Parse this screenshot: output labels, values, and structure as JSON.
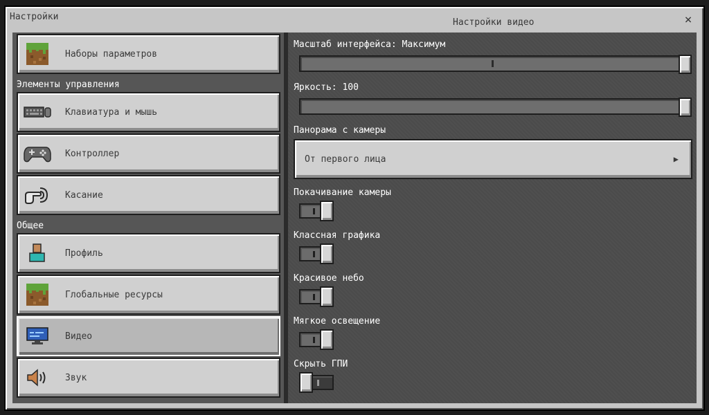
{
  "header": {
    "left_title": "Настройки",
    "center_title": "Настройки видео",
    "close_glyph": "×"
  },
  "sidebar": {
    "top_item": {
      "label": "Наборы параметров",
      "icon": "grass-block-icon"
    },
    "section_controls": "Элементы управления",
    "controls": [
      {
        "label": "Клавиатура и мышь",
        "icon": "keyboard-mouse-icon"
      },
      {
        "label": "Контроллер",
        "icon": "gamepad-icon"
      },
      {
        "label": "Касание",
        "icon": "touch-icon"
      }
    ],
    "section_general": "Общее",
    "general": [
      {
        "label": "Профиль",
        "icon": "profile-icon"
      },
      {
        "label": "Глобальные ресурсы",
        "icon": "grass-block-icon"
      },
      {
        "label": "Видео",
        "icon": "monitor-icon",
        "active": true
      },
      {
        "label": "Звук",
        "icon": "speaker-icon"
      }
    ]
  },
  "settings": {
    "ui_scale": {
      "label": "Масштаб интерфейса: Максимум",
      "level": 1.0
    },
    "brightness": {
      "label": "Яркость: 100",
      "value": 100,
      "level": 1.0
    },
    "camera_perspective": {
      "label": "Панорама с камеры",
      "value": "От первого лица"
    },
    "toggles": [
      {
        "label": "Покачивание камеры",
        "on": true
      },
      {
        "label": "Классная графика",
        "on": true
      },
      {
        "label": "Красивое небо",
        "on": true
      },
      {
        "label": "Мягкое освещение",
        "on": true
      },
      {
        "label": "Скрыть ГПИ",
        "on": false
      }
    ]
  },
  "colors": {
    "panel_left": "#565656",
    "panel_right": "#4c4c4c",
    "button_face": "#d0d0d0",
    "frame": "#c6c6c6"
  }
}
